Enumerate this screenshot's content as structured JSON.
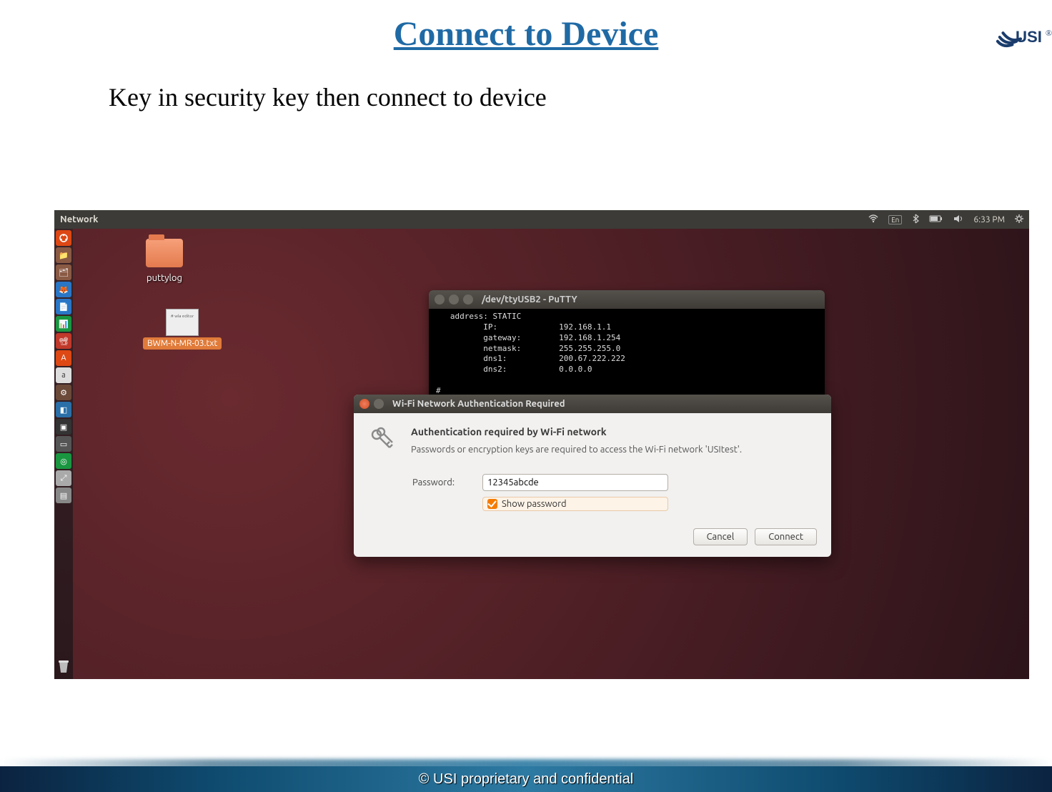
{
  "slide": {
    "title": "Connect to Device",
    "subtitle": "Key in security key then connect to device",
    "copyright": "© USI proprietary and confidential"
  },
  "topbar": {
    "title": "Network",
    "lang": "En",
    "time": "6:33 PM"
  },
  "desktop": {
    "folder_label": "puttylog",
    "file_icon_text": "# wla editor",
    "file_label": "BWM-N-MR-03.txt"
  },
  "putty": {
    "title": "/dev/ttyUSB2 - PuTTY",
    "body": "   address: STATIC\n          IP:             192.168.1.1\n          gateway:        192.168.1.254\n          netmask:        255.255.255.0\n          dns1:           200.67.222.222\n          dns2:           0.0.0.0\n\n#\n# wlan-stop uap-network\ncommand 'wlan-stop' not found\n\n# wlan-stop-network uap-network"
  },
  "auth": {
    "window_title": "Wi-Fi Network Authentication Required",
    "heading": "Authentication required by Wi-Fi network",
    "description": "Passwords or encryption keys are required to access the Wi-Fi network 'USItest'.",
    "password_label": "Password:",
    "password_value": "12345abcde",
    "show_password_label": "Show password",
    "cancel": "Cancel",
    "connect": "Connect"
  }
}
